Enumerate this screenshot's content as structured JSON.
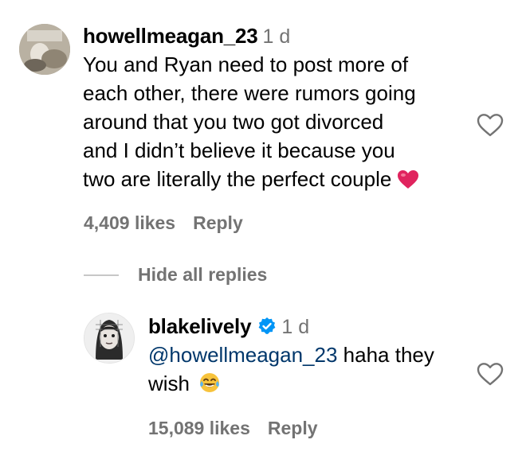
{
  "comment": {
    "username": "howellmeagan_23",
    "time": "1 d",
    "text_lines": [
      "You and Ryan need to post more of",
      "each other, there were rumors going",
      "around that you two got divorced",
      "and I didn’t believe it because you",
      "two are literally the perfect couple"
    ],
    "text_emoji": "heart-emoji",
    "likes": "4,409 likes",
    "reply_label": "Reply"
  },
  "thread": {
    "hide_label": "Hide all replies"
  },
  "reply": {
    "username": "blakelively",
    "verified": true,
    "time": "1 d",
    "mention": "@howellmeagan_23",
    "text_line1": " haha they",
    "text_line2": "wish",
    "text_emoji": "tears-of-joy-emoji",
    "likes": "15,089 likes",
    "reply_label": "Reply"
  },
  "colors": {
    "text": "#000000",
    "secondary": "#737373",
    "mention": "#00376b",
    "verified": "#0095f6",
    "heart_emoji": "#e0245e"
  }
}
